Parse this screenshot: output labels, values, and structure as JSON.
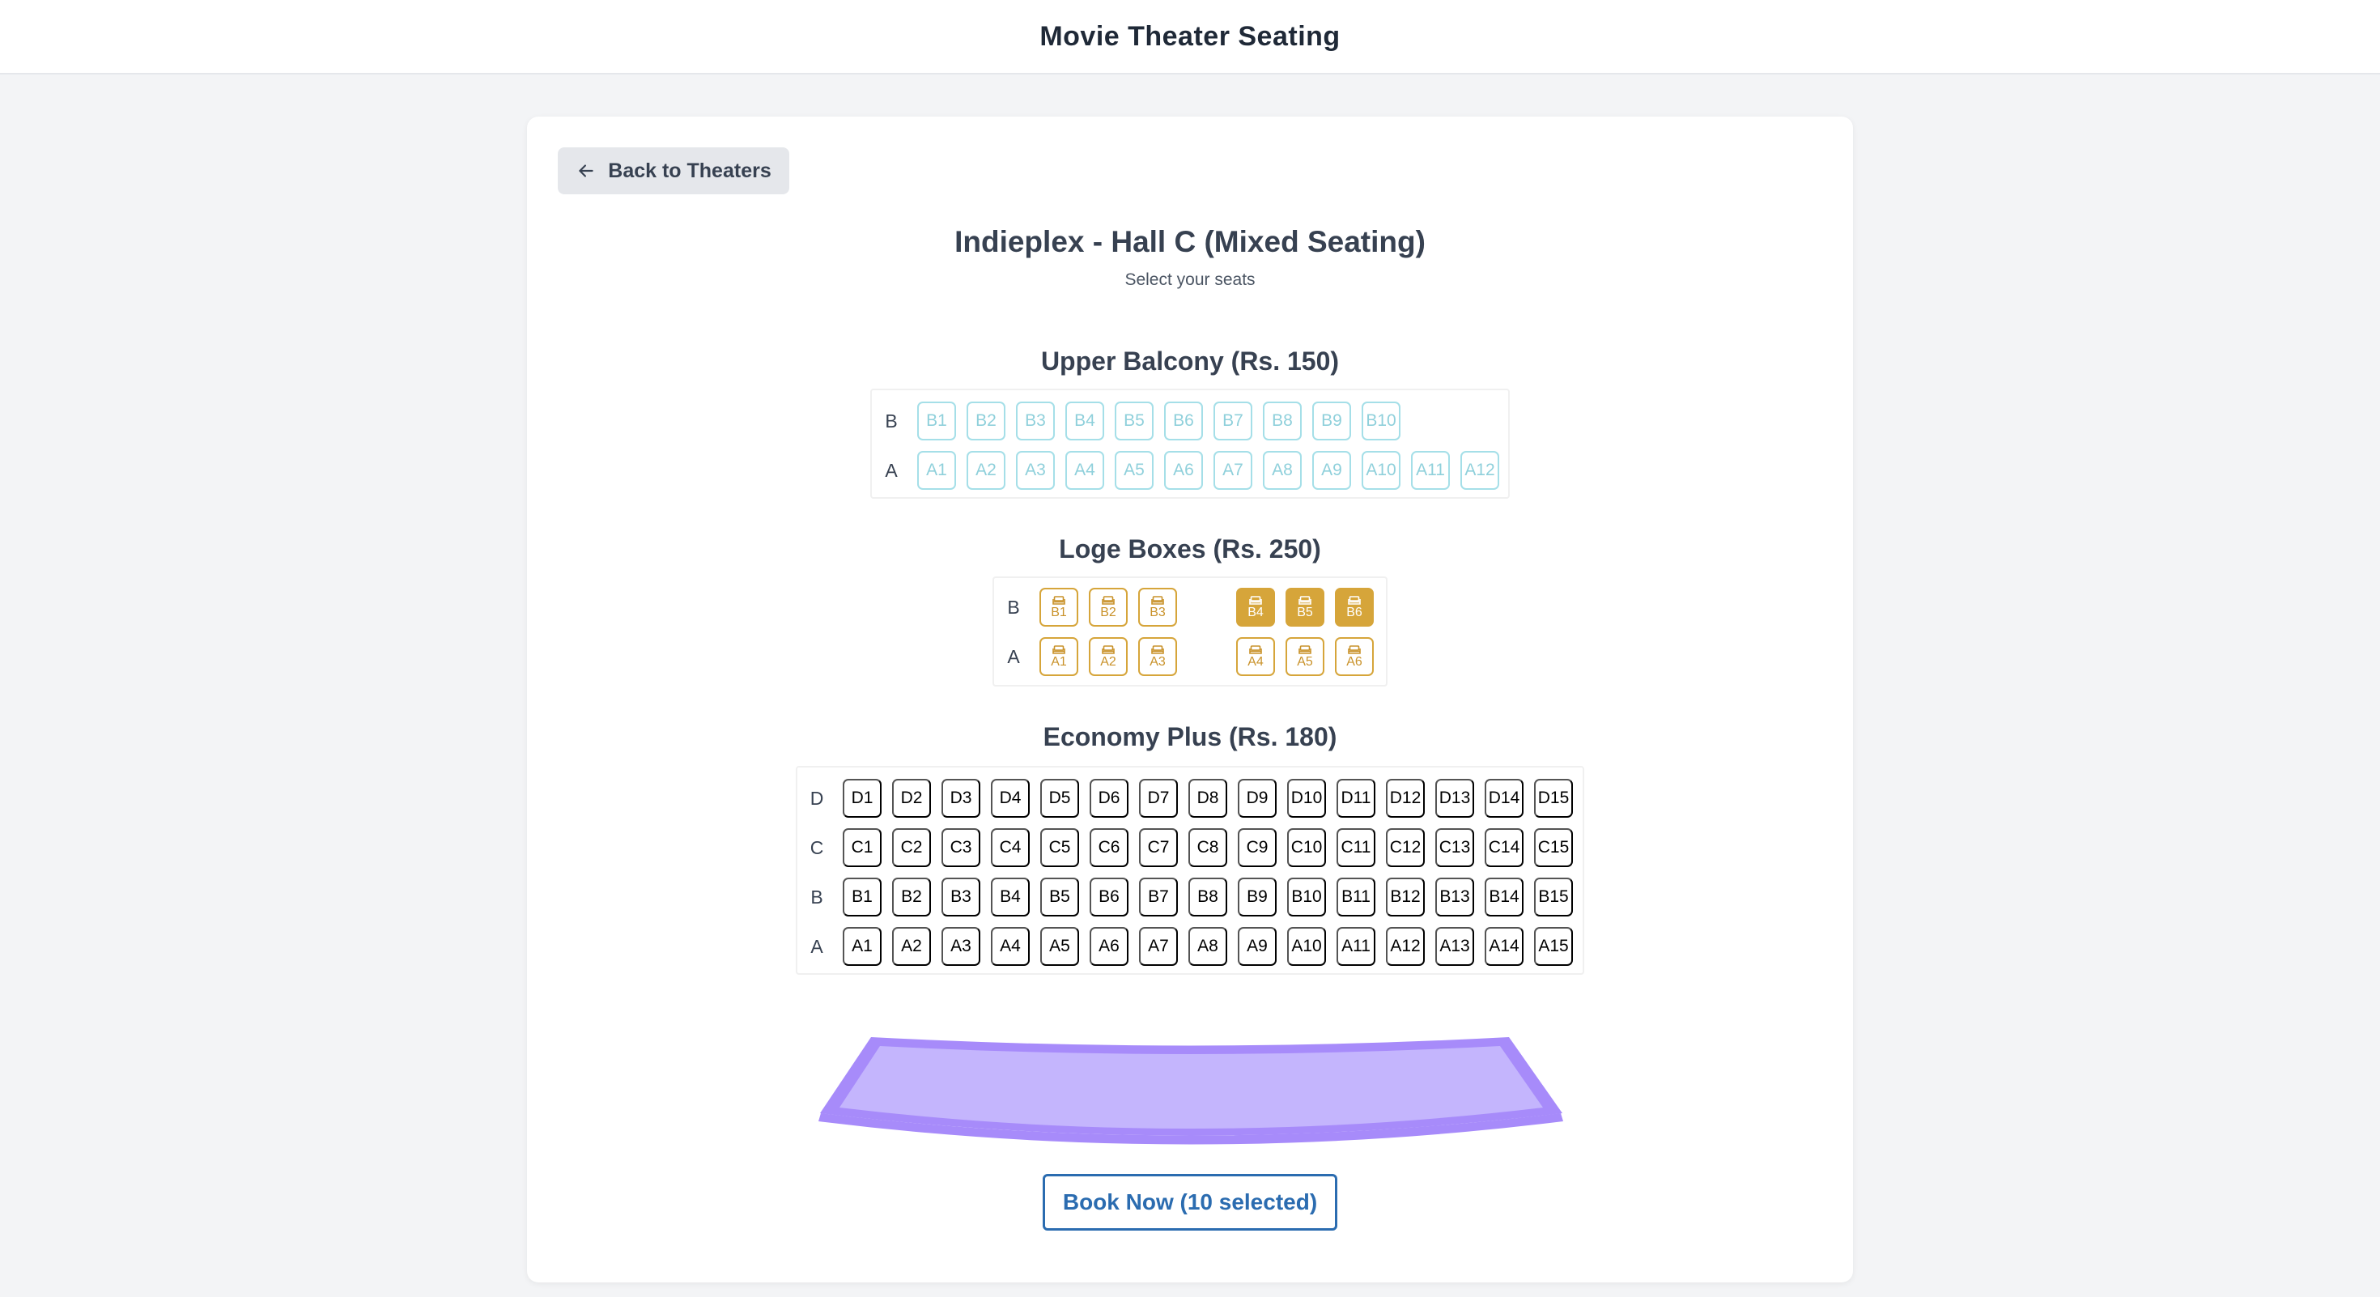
{
  "header": {
    "title": "Movie Theater Seating"
  },
  "back_button": {
    "label": "Back to Theaters",
    "icon": "arrow-left-icon"
  },
  "hall": {
    "title": "Indieplex - Hall C (Mixed Seating)",
    "subtitle": "Select your seats"
  },
  "colors": {
    "balcony_seat": "#a5dfe8",
    "loge_seat": "#d6a53a",
    "economy_seat": "#8ee79f",
    "screen": "#c4b5fd",
    "book_button": "#2b6cb0"
  },
  "sections": [
    {
      "key": "balcony",
      "title": "Upper Balcony (Rs. 150)",
      "rows": [
        {
          "label": "B",
          "seats": [
            {
              "label": "B1",
              "selected": false
            },
            {
              "label": "B2",
              "selected": false
            },
            {
              "label": "B3",
              "selected": false
            },
            {
              "label": "B4",
              "selected": false
            },
            {
              "label": "B5",
              "selected": false
            },
            {
              "label": "B6",
              "selected": false
            },
            {
              "label": "B7",
              "selected": false
            },
            {
              "label": "B8",
              "selected": false
            },
            {
              "label": "B9",
              "selected": false
            },
            {
              "label": "B10",
              "selected": false
            }
          ]
        },
        {
          "label": "A",
          "seats": [
            {
              "label": "A1",
              "selected": false
            },
            {
              "label": "A2",
              "selected": false
            },
            {
              "label": "A3",
              "selected": false
            },
            {
              "label": "A4",
              "selected": false
            },
            {
              "label": "A5",
              "selected": false
            },
            {
              "label": "A6",
              "selected": false
            },
            {
              "label": "A7",
              "selected": false
            },
            {
              "label": "A8",
              "selected": false
            },
            {
              "label": "A9",
              "selected": false
            },
            {
              "label": "A10",
              "selected": false
            },
            {
              "label": "A11",
              "selected": false
            },
            {
              "label": "A12",
              "selected": false
            }
          ]
        }
      ]
    },
    {
      "key": "loge",
      "title": "Loge Boxes (Rs. 250)",
      "rows": [
        {
          "label": "B",
          "seats": [
            {
              "label": "B1",
              "selected": false
            },
            {
              "label": "B2",
              "selected": false
            },
            {
              "label": "B3",
              "selected": false
            },
            {
              "label": "B4",
              "selected": true
            },
            {
              "label": "B5",
              "selected": true
            },
            {
              "label": "B6",
              "selected": true
            }
          ]
        },
        {
          "label": "A",
          "seats": [
            {
              "label": "A1",
              "selected": false
            },
            {
              "label": "A2",
              "selected": false
            },
            {
              "label": "A3",
              "selected": false
            },
            {
              "label": "A4",
              "selected": false
            },
            {
              "label": "A5",
              "selected": false
            },
            {
              "label": "A6",
              "selected": false
            }
          ]
        }
      ]
    },
    {
      "key": "economy",
      "title": "Economy Plus (Rs. 180)",
      "rows": [
        {
          "label": "D",
          "seats": [
            {
              "label": "D1",
              "selected": false
            },
            {
              "label": "D2",
              "selected": false
            },
            {
              "label": "D3",
              "selected": false
            },
            {
              "label": "D4",
              "selected": false
            },
            {
              "label": "D5",
              "selected": false
            },
            {
              "label": "D6",
              "selected": false
            },
            {
              "label": "D7",
              "selected": false
            },
            {
              "label": "D8",
              "selected": true
            },
            {
              "label": "D9",
              "selected": true
            },
            {
              "label": "D10",
              "selected": false
            },
            {
              "label": "D11",
              "selected": false
            },
            {
              "label": "D12",
              "selected": false
            },
            {
              "label": "D13",
              "selected": false
            },
            {
              "label": "D14",
              "selected": false
            },
            {
              "label": "D15",
              "selected": false
            }
          ]
        },
        {
          "label": "C",
          "seats": [
            {
              "label": "C1",
              "selected": false
            },
            {
              "label": "C2",
              "selected": false
            },
            {
              "label": "C3",
              "selected": false
            },
            {
              "label": "C4",
              "selected": false
            },
            {
              "label": "C5",
              "selected": false
            },
            {
              "label": "C6",
              "selected": false
            },
            {
              "label": "C7",
              "selected": false
            },
            {
              "label": "C8",
              "selected": false
            },
            {
              "label": "C9",
              "selected": false
            },
            {
              "label": "C10",
              "selected": false
            },
            {
              "label": "C11",
              "selected": false
            },
            {
              "label": "C12",
              "selected": false
            },
            {
              "label": "C13",
              "selected": true
            },
            {
              "label": "C14",
              "selected": false
            },
            {
              "label": "C15",
              "selected": false
            }
          ]
        },
        {
          "label": "B",
          "seats": [
            {
              "label": "B1",
              "selected": false
            },
            {
              "label": "B2",
              "selected": false
            },
            {
              "label": "B3",
              "selected": false
            },
            {
              "label": "B4",
              "selected": false
            },
            {
              "label": "B5",
              "selected": false
            },
            {
              "label": "B6",
              "selected": true
            },
            {
              "label": "B7",
              "selected": false
            },
            {
              "label": "B8",
              "selected": false
            },
            {
              "label": "B9",
              "selected": true
            },
            {
              "label": "B10",
              "selected": false
            },
            {
              "label": "B11",
              "selected": true
            },
            {
              "label": "B12",
              "selected": false
            },
            {
              "label": "B13",
              "selected": false
            },
            {
              "label": "B14",
              "selected": false
            },
            {
              "label": "B15",
              "selected": false
            }
          ]
        },
        {
          "label": "A",
          "seats": [
            {
              "label": "A1",
              "selected": false
            },
            {
              "label": "A2",
              "selected": false
            },
            {
              "label": "A3",
              "selected": false
            },
            {
              "label": "A4",
              "selected": false
            },
            {
              "label": "A5",
              "selected": false
            },
            {
              "label": "A6",
              "selected": false
            },
            {
              "label": "A7",
              "selected": false
            },
            {
              "label": "A8",
              "selected": false
            },
            {
              "label": "A9",
              "selected": true
            },
            {
              "label": "A10",
              "selected": false
            },
            {
              "label": "A11",
              "selected": false
            },
            {
              "label": "A12",
              "selected": false
            },
            {
              "label": "A13",
              "selected": false
            },
            {
              "label": "A14",
              "selected": false
            },
            {
              "label": "A15",
              "selected": false
            }
          ]
        }
      ]
    }
  ],
  "book_button": {
    "label": "Book Now (10 selected)"
  }
}
